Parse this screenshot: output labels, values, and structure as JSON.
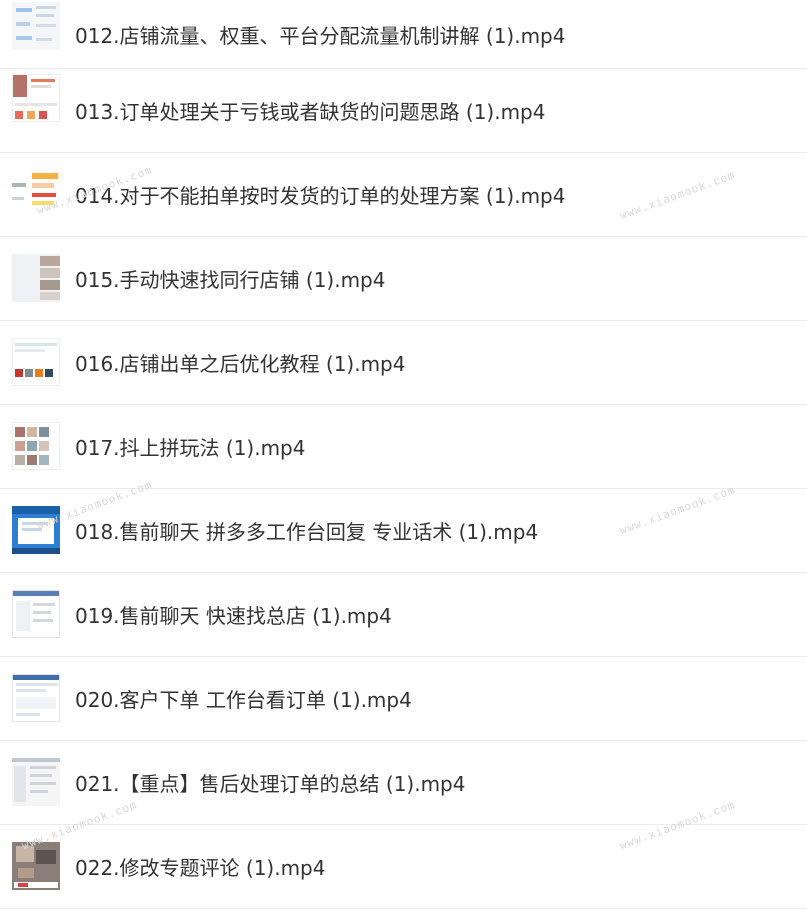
{
  "files": [
    {
      "name": "012.店铺流量、权重、平台分配流量机制讲解 (1).mp4",
      "thumb_icon": "mindmap-thumbnail-icon"
    },
    {
      "name": "013.订单处理关于亏钱或者缺货的问题思路 (1).mp4",
      "thumb_icon": "webpage-thumbnail-icon"
    },
    {
      "name": "014.对于不能拍单按时发货的订单的处理方案 (1).mp4",
      "thumb_icon": "mindmap-thumbnail-icon"
    },
    {
      "name": "015.手动快速找同行店铺 (1).mp4",
      "thumb_icon": "webpage-thumbnail-icon"
    },
    {
      "name": "016.店铺出单之后优化教程 (1).mp4",
      "thumb_icon": "webpage-thumbnail-icon"
    },
    {
      "name": "017.抖上拼玩法 (1).mp4",
      "thumb_icon": "webpage-thumbnail-icon"
    },
    {
      "name": "018.售前聊天 拼多多工作台回复 专业话术 (1).mp4",
      "thumb_icon": "desktop-thumbnail-icon"
    },
    {
      "name": "019.售前聊天 快速找总店 (1).mp4",
      "thumb_icon": "webpage-thumbnail-icon"
    },
    {
      "name": "020.客户下单 工作台看订单 (1).mp4",
      "thumb_icon": "webpage-thumbnail-icon"
    },
    {
      "name": "021.【重点】售后处理订单的总结 (1).mp4",
      "thumb_icon": "webpage-thumbnail-icon"
    },
    {
      "name": "022.修改专题评论 (1).mp4",
      "thumb_icon": "photo-thumbnail-icon"
    }
  ],
  "watermarks": [
    "www.xiaomook.com",
    "www.xiaomook.com",
    "www.xiaomook.com",
    "www.xiaomook.com",
    "www.xiaomook.com",
    "www.xiaomook.com"
  ],
  "colors": {
    "text": "#333333",
    "divider": "#ececec",
    "watermark": "#d8d8d8"
  }
}
